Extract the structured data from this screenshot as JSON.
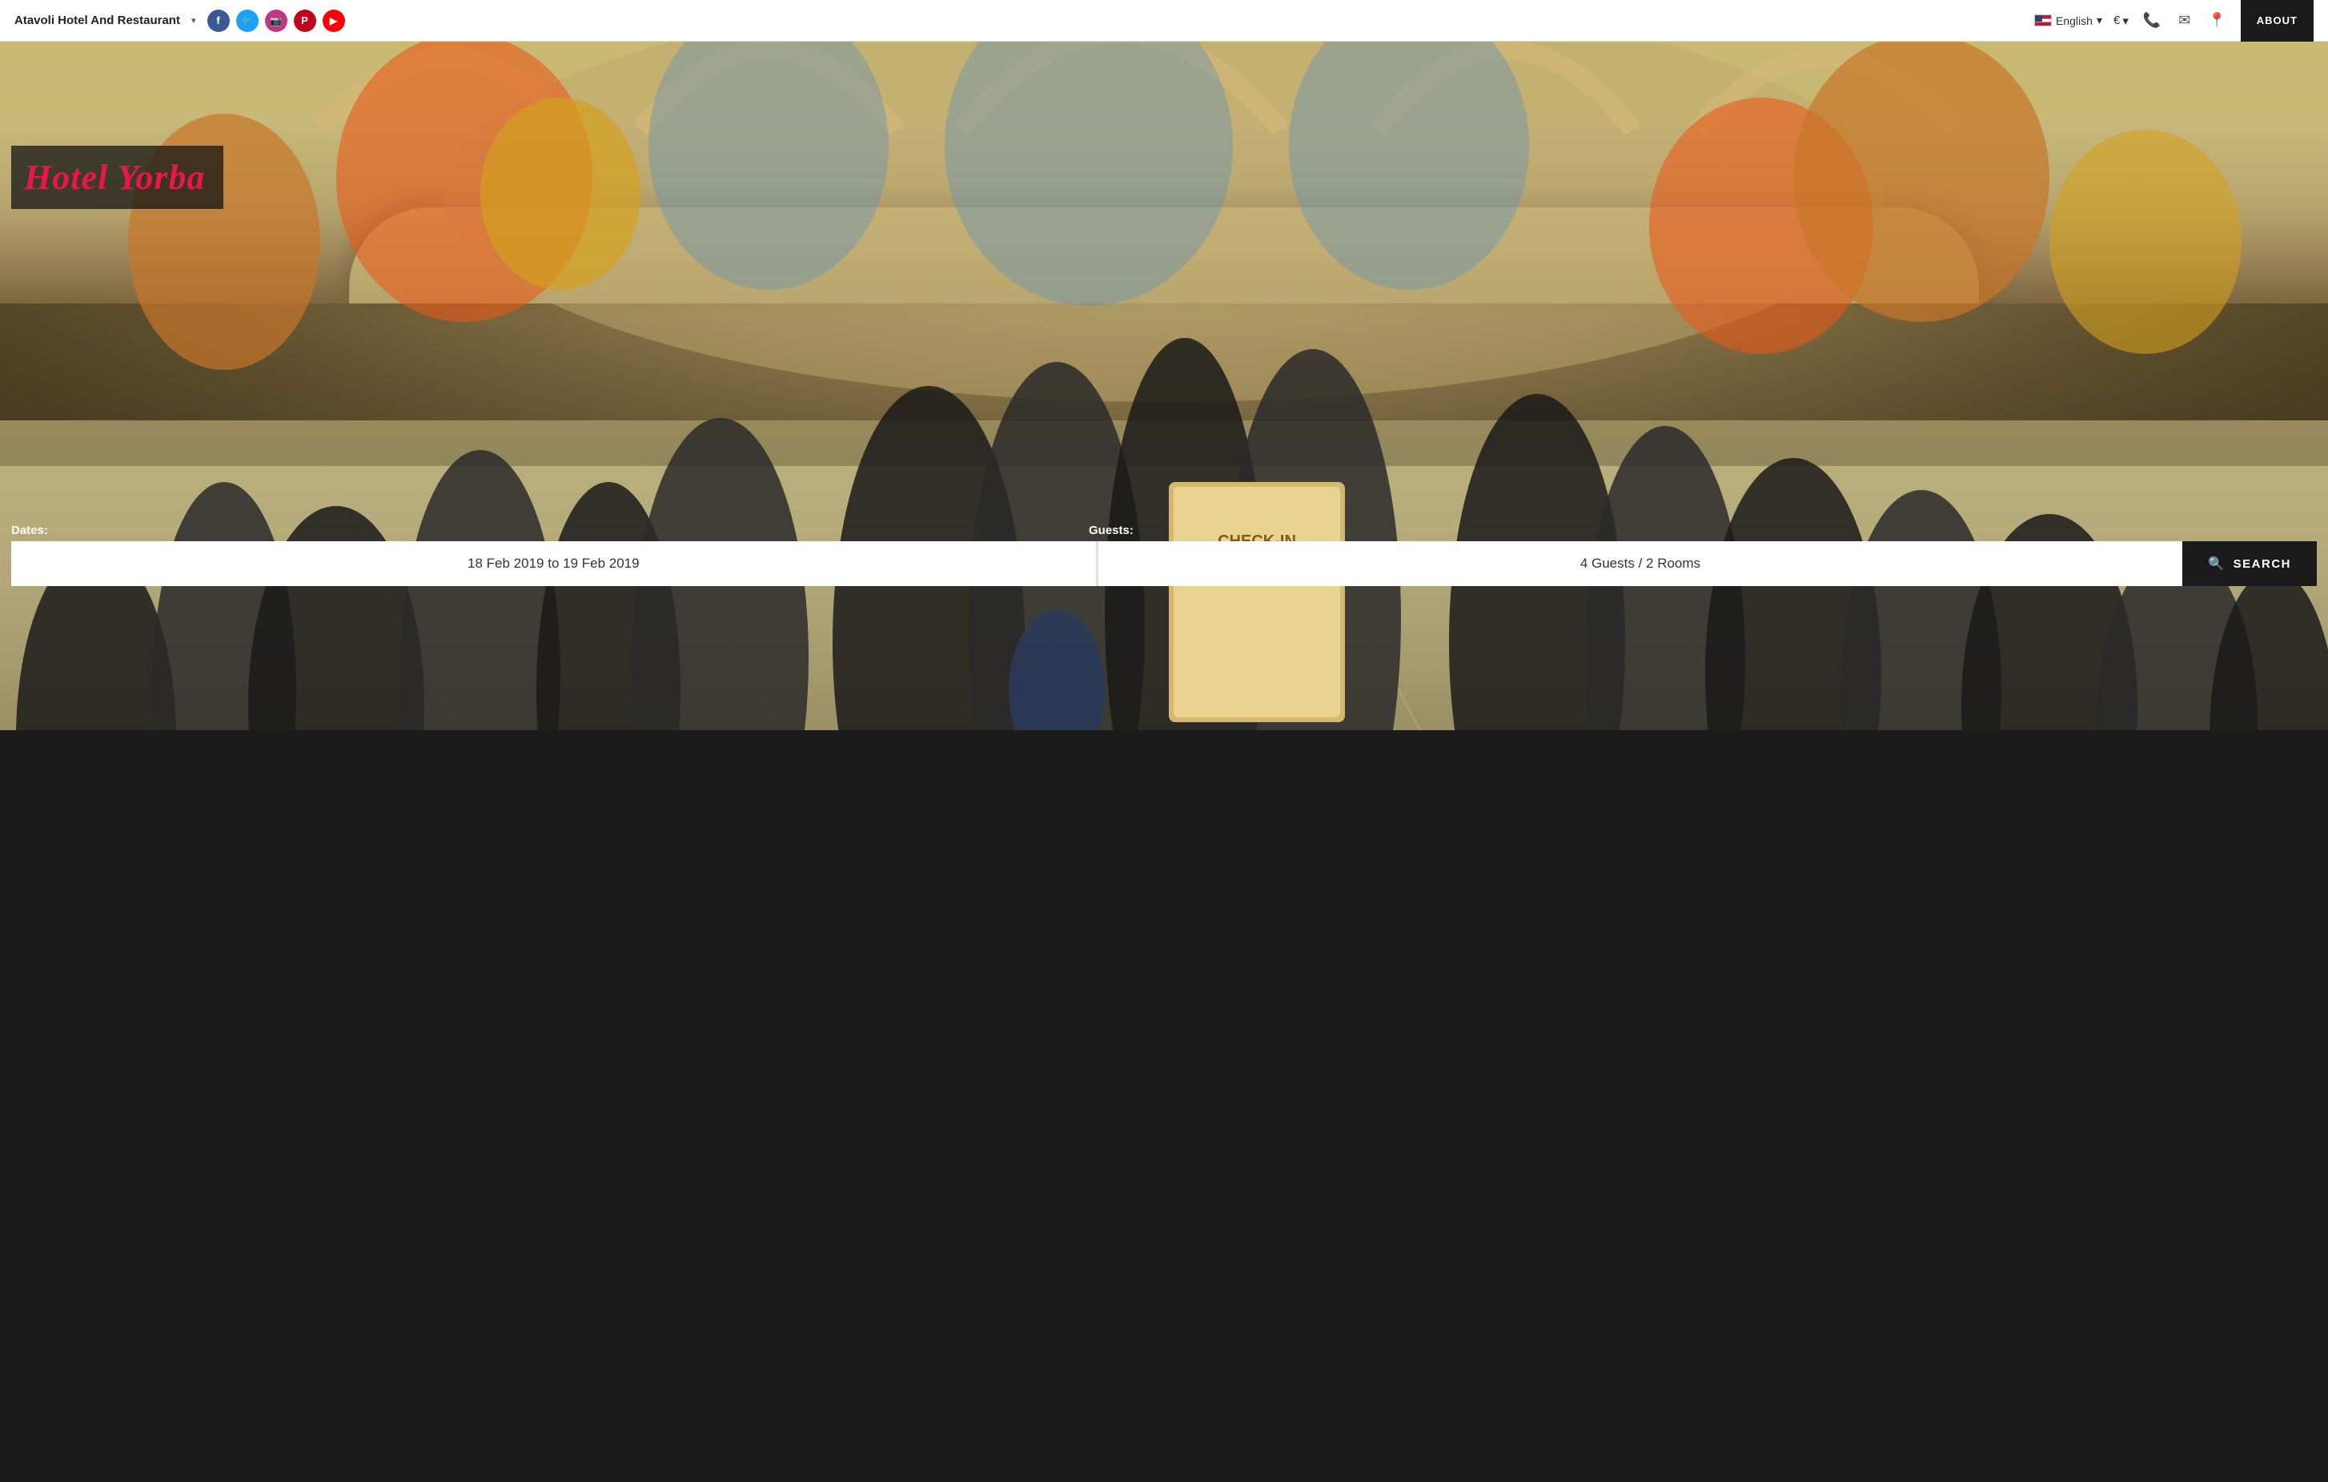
{
  "navbar": {
    "brand": "Atavoli Hotel And Restaurant",
    "social_links": [
      {
        "name": "facebook",
        "label": "f"
      },
      {
        "name": "twitter",
        "label": "t"
      },
      {
        "name": "instagram",
        "label": "in"
      },
      {
        "name": "pinterest",
        "label": "p"
      },
      {
        "name": "youtube",
        "label": "▶"
      }
    ],
    "language": "English",
    "currency": "€",
    "about_label": "ABOUT"
  },
  "hero": {
    "hotel_name": "Hotel Yorba",
    "search": {
      "dates_label": "Dates:",
      "guests_label": "Guests:",
      "dates_value": "18 Feb 2019 to 19 Feb 2019",
      "guests_value": "4 Guests / 2 Rooms",
      "search_btn": "SEARCH"
    }
  }
}
